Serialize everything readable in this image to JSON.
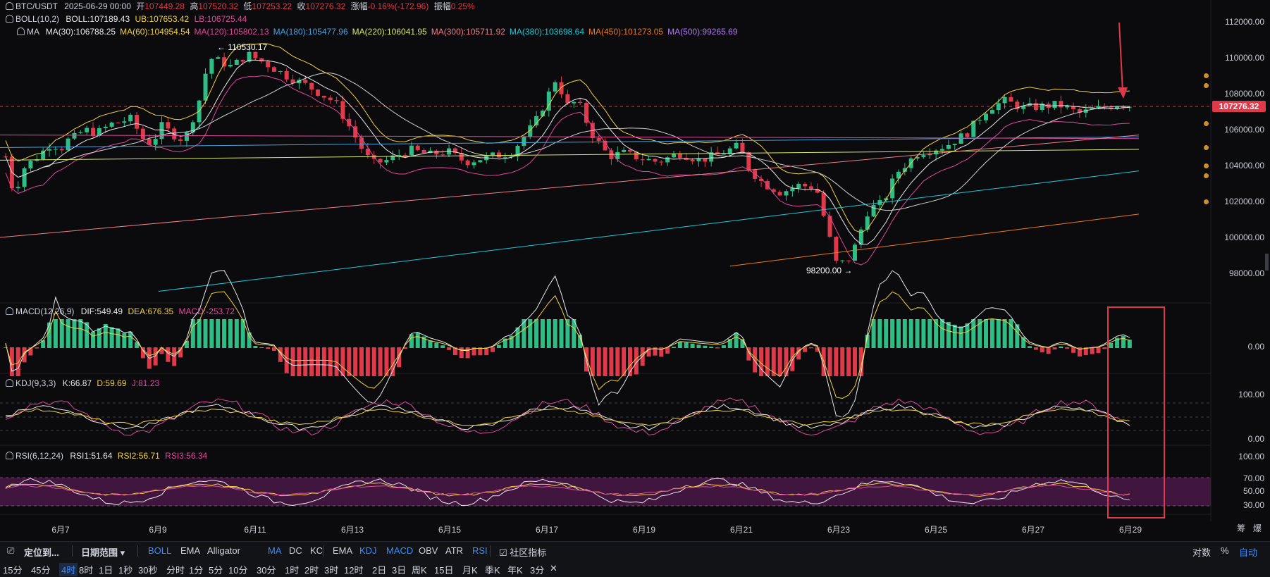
{
  "header": {
    "symbol": "BTC/USDT",
    "datetime": "2025-06-29 00:00",
    "open_label": "开",
    "open": "107449.28",
    "high_label": "高",
    "high": "107520.32",
    "low_label": "低",
    "low": "107253.22",
    "close_label": "收",
    "close": "107276.32",
    "change_label": "涨幅",
    "change": "-0.16%(-172.96)",
    "amp_label": "振幅",
    "amp": "0.25%"
  },
  "boll": {
    "name": "BOLL(10,2)",
    "boll": "BOLL:107189.43",
    "ub": "UB:107653.42",
    "lb": "LB:106725.44"
  },
  "ma": {
    "name": "MA",
    "items": [
      {
        "t": "MA(30):106788.25",
        "color": "#e8e8e8"
      },
      {
        "t": "MA(60):104954.54",
        "color": "#f2d23c"
      },
      {
        "t": "MA(120):105802.13",
        "color": "#e0489b"
      },
      {
        "t": "MA(180):105477.96",
        "color": "#4aa3e0"
      },
      {
        "t": "MA(220):106041.95",
        "color": "#d8e86a"
      },
      {
        "t": "MA(300):105711.92",
        "color": "#f07c8c"
      },
      {
        "t": "MA(380):103698.64",
        "color": "#1ec8d8"
      },
      {
        "t": "MA(450):101273.05",
        "color": "#f07a18"
      },
      {
        "t": "MA(500):99265.69",
        "color": "#b07cf0"
      }
    ]
  },
  "annotations": {
    "high_mark": "110530.17",
    "low_mark": "98200.00"
  },
  "price_axis": [
    "112000.00",
    "110000.00",
    "108000.00",
    "106000.00",
    "104000.00",
    "102000.00",
    "100000.00",
    "98000.00"
  ],
  "last_price": "107276.32",
  "macd": {
    "name": "MACD(12,26,9)",
    "dif": "DIF:549.49",
    "dea": "DEA:676.35",
    "macd": "MACD:-253.72",
    "axis": [
      "0.00"
    ]
  },
  "kdj": {
    "name": "KDJ(9,3,3)",
    "k": "K:66.87",
    "d": "D:59.69",
    "j": "J:81.23",
    "axis": [
      "100.00",
      "0.00"
    ]
  },
  "rsi": {
    "name": "RSI(6,12,24)",
    "r1": "RSI1:51.64",
    "r2": "RSI2:56.71",
    "r3": "RSI3:56.34",
    "axis": [
      "100.00",
      "70.00",
      "50.00",
      "30.00"
    ]
  },
  "time_axis": [
    "6月7",
    "6月9",
    "6月11",
    "6月13",
    "6月15",
    "6月17",
    "6月19",
    "6月21",
    "6月23",
    "6月25",
    "6月27",
    "6月29"
  ],
  "axis_right_labels": {
    "a": "筹",
    "b": "爆"
  },
  "toolbar": {
    "locate": "定位到...",
    "range": "日期范围",
    "indicators": [
      {
        "t": "BOLL",
        "active": true
      },
      {
        "t": "EMA",
        "active": false
      },
      {
        "t": "Alligator",
        "active": false
      },
      {
        "t": "MA",
        "active": true
      },
      {
        "t": "DC",
        "active": false
      },
      {
        "t": "KC",
        "active": false
      }
    ],
    "sub_indicators": [
      {
        "t": "EMA",
        "active": false
      },
      {
        "t": "KDJ",
        "active": true
      },
      {
        "t": "MACD",
        "active": true
      },
      {
        "t": "OBV",
        "active": false
      },
      {
        "t": "ATR",
        "active": false
      },
      {
        "t": "RSI",
        "active": true
      }
    ],
    "community": "社区指标",
    "right": {
      "log": "对数",
      "pct": "%",
      "auto": "自动"
    }
  },
  "periods": [
    {
      "t": "15分",
      "active": false
    },
    {
      "t": "45分",
      "active": false
    },
    {
      "t": "4时",
      "active": true
    },
    {
      "t": "8时",
      "active": false
    },
    {
      "t": "1日",
      "active": false
    },
    {
      "t": "1秒",
      "active": false
    },
    {
      "t": "30秒",
      "active": false
    },
    {
      "t": "分时",
      "active": false
    },
    {
      "t": "1分",
      "active": false
    },
    {
      "t": "5分",
      "active": false
    },
    {
      "t": "10分",
      "active": false
    },
    {
      "t": "30分",
      "active": false
    },
    {
      "t": "1时",
      "active": false
    },
    {
      "t": "2时",
      "active": false
    },
    {
      "t": "3时",
      "active": false
    },
    {
      "t": "12时",
      "active": false
    },
    {
      "t": "2日",
      "active": false
    },
    {
      "t": "3日",
      "active": false
    },
    {
      "t": "周K",
      "active": false
    },
    {
      "t": "15日",
      "active": false
    },
    {
      "t": "月K",
      "active": false
    },
    {
      "t": "季K",
      "active": false
    },
    {
      "t": "年K",
      "active": false
    },
    {
      "t": "3分",
      "active": false
    }
  ],
  "colors": {
    "up": "#2ebd85",
    "down": "#e0394a",
    "bg": "#0b0b0e",
    "accent": "#3b8cff"
  }
}
